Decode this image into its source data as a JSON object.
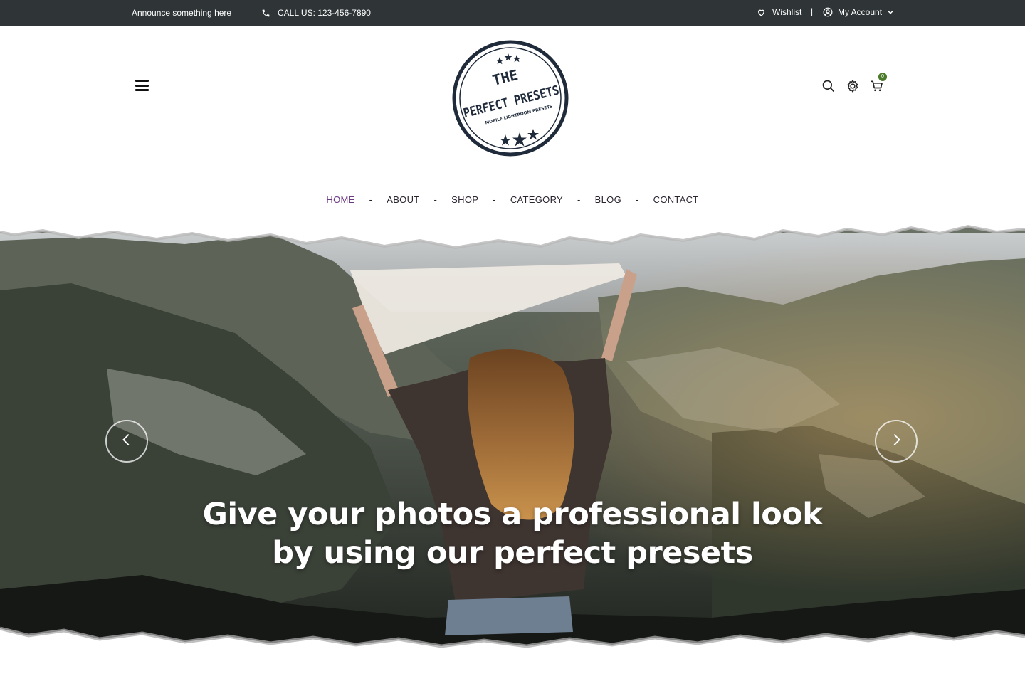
{
  "topbar": {
    "announce": "Announce something here",
    "phone": "CALL US: 123-456-7890",
    "wishlist": "Wishlist",
    "separator": "|",
    "account": "My Account"
  },
  "logo": {
    "line1": "THE",
    "line2": "PERFECT PRESETS",
    "tagline": "MOBILE LIGHTROOM PRESETS"
  },
  "header": {
    "cart_count": "0"
  },
  "nav": {
    "items": [
      {
        "label": "HOME",
        "active": true
      },
      {
        "label": "ABOUT"
      },
      {
        "label": "SHOP"
      },
      {
        "label": "CATEGORY"
      },
      {
        "label": "BLOG"
      },
      {
        "label": "CONTACT"
      }
    ],
    "separator": "-"
  },
  "hero": {
    "title_line1": "Give your photos a professional look",
    "title_line2": "by using our perfect presets"
  },
  "colors": {
    "topbar_bg": "#2f3537",
    "nav_active": "#6b3a83",
    "cart_badge": "#4a7a2a",
    "logo_ink": "#1f2a3a"
  },
  "icons": {
    "phone": "phone-icon",
    "wishlist": "heart-icon",
    "account": "user-circle-icon",
    "menu": "hamburger-icon",
    "search": "search-icon",
    "settings": "gear-icon",
    "cart": "cart-icon",
    "prev": "chevron-left-icon",
    "next": "chevron-right-icon"
  }
}
